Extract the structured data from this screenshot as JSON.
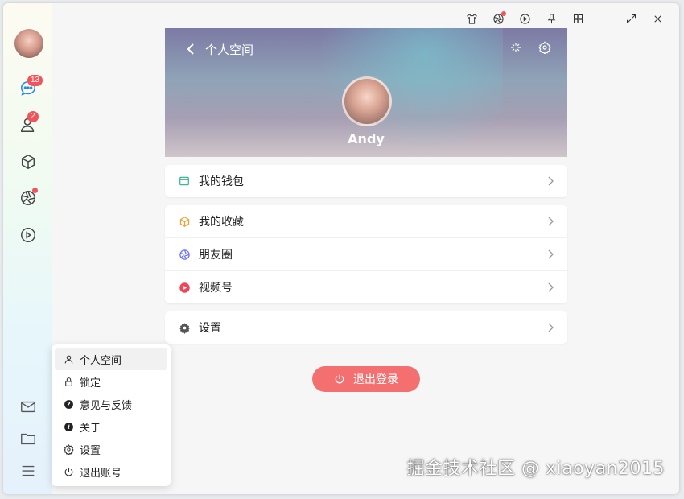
{
  "titlebar": {
    "icons": [
      "tshirt-icon",
      "aperture-icon",
      "play-icon",
      "pin-icon",
      "grid-icon",
      "minimize-icon",
      "maximize-icon",
      "close-icon"
    ]
  },
  "sidebar": {
    "items": [
      {
        "name": "chat",
        "badge": "13"
      },
      {
        "name": "contacts",
        "badge": "2"
      },
      {
        "name": "box"
      },
      {
        "name": "moments"
      },
      {
        "name": "video"
      }
    ]
  },
  "hero": {
    "title": "个人空间",
    "username": "Andy"
  },
  "menu": {
    "wallet": "我的钱包",
    "favorites": "我的收藏",
    "moments": "朋友圈",
    "channels": "视频号",
    "settings": "设置"
  },
  "logout": {
    "label": "退出登录"
  },
  "popup": {
    "items": [
      "个人空间",
      "锁定",
      "意见与反馈",
      "关于",
      "设置",
      "退出账号"
    ]
  },
  "watermark": "掘金技术社区 @ xiaoyan2015",
  "colors": {
    "accent": "#f47070",
    "badge": "#f2545b",
    "wallet": "#27b08c",
    "favorites": "#f0a132",
    "moments": "#6c73f2",
    "channels": "#f0445a"
  }
}
